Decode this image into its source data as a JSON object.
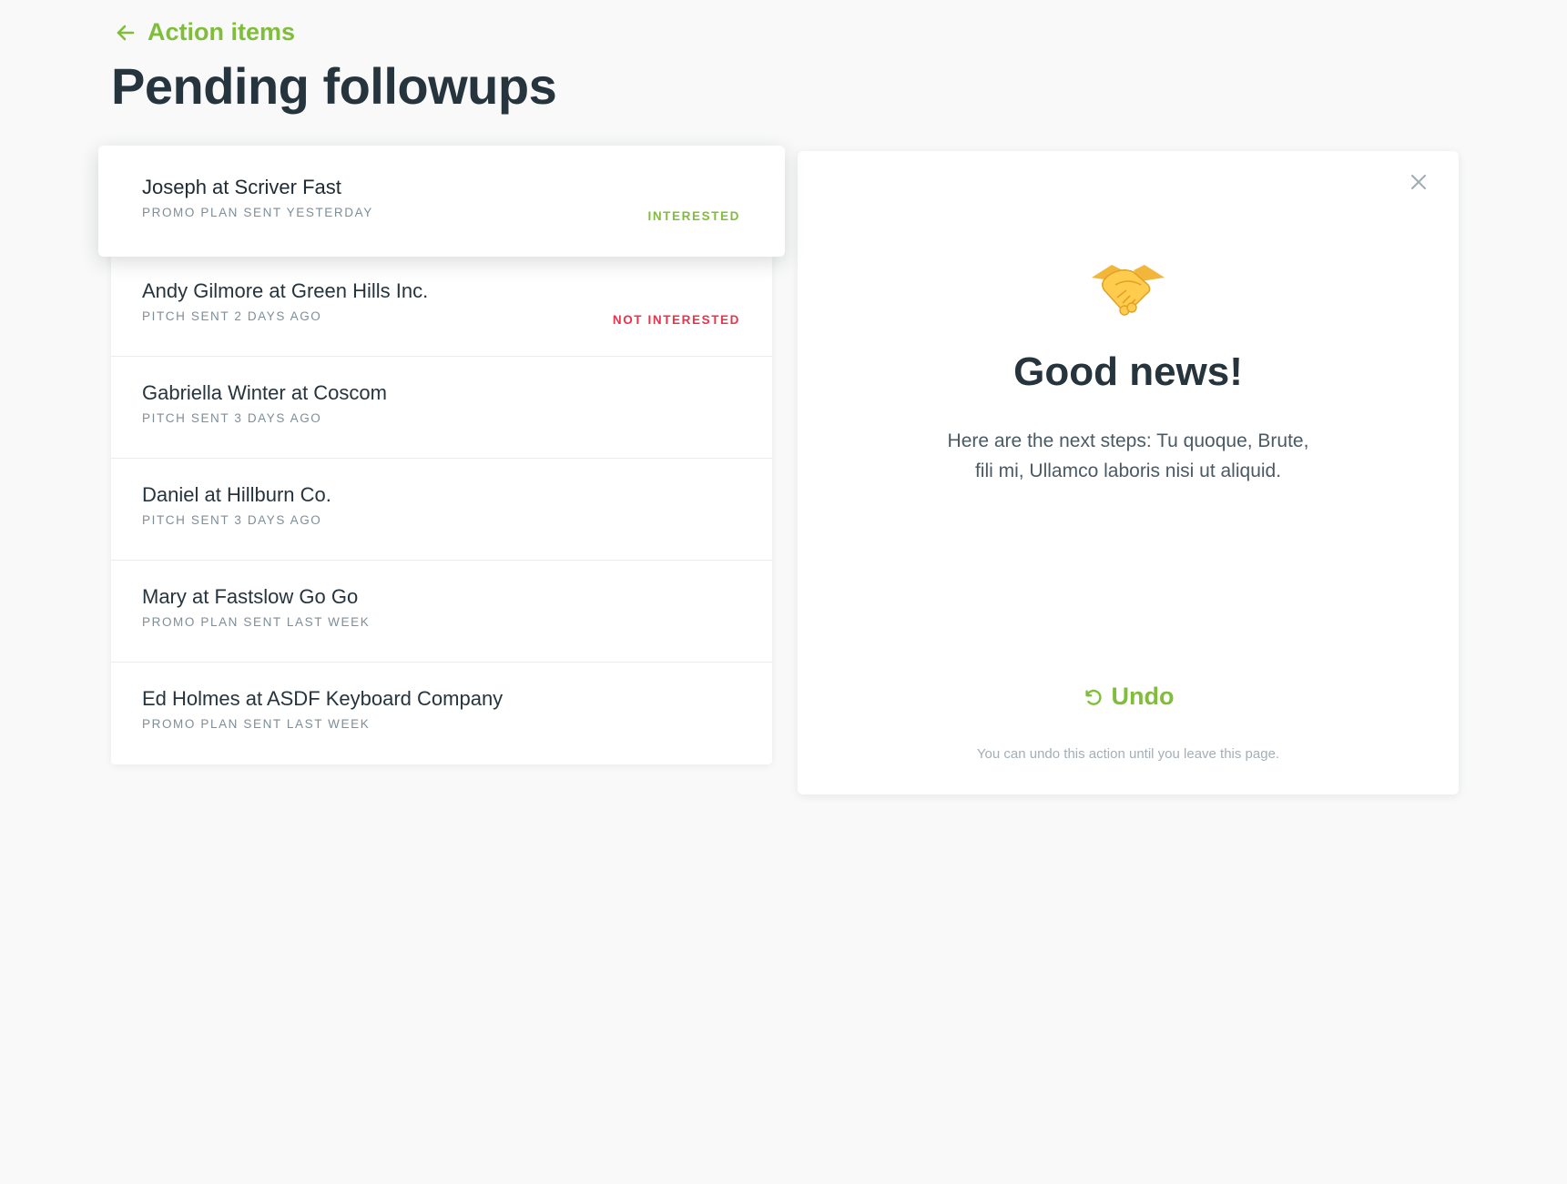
{
  "header": {
    "back_label": "Action items",
    "title": "Pending followups"
  },
  "followups": [
    {
      "name": "Joseph at Scriver Fast",
      "sub": "Promo plan sent yesterday",
      "status": "Interested"
    },
    {
      "name": "Andy Gilmore at Green Hills Inc.",
      "sub": "Pitch sent 2 days ago",
      "status": "Not interested"
    },
    {
      "name": "Gabriella Winter at Coscom",
      "sub": "Pitch sent 3 days ago",
      "status": ""
    },
    {
      "name": "Daniel at Hillburn Co.",
      "sub": "Pitch sent 3 days ago",
      "status": ""
    },
    {
      "name": "Mary at Fastslow Go Go",
      "sub": "Promo plan sent last week",
      "status": ""
    },
    {
      "name": "Ed Holmes at ASDF Keyboard Company",
      "sub": "Promo plan sent last week",
      "status": ""
    }
  ],
  "panel": {
    "icon": "handshake-icon",
    "title": "Good news!",
    "body_line1": "Here are the next steps: Tu quoque, Brute,",
    "body_line2": "fili mi, Ullamco laboris nisi ut aliquid.",
    "undo_label": "Undo",
    "undo_note": "You can undo this action until you leave this page."
  },
  "colors": {
    "accent": "#7fbd3a",
    "danger": "#e8334a",
    "text": "#26343d",
    "muted": "#7d8e99"
  }
}
